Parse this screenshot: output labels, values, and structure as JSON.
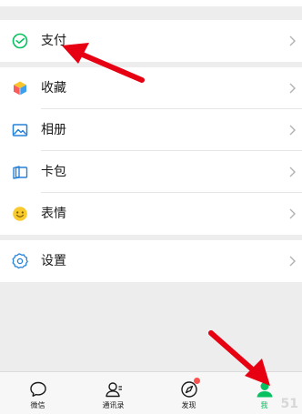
{
  "menu": {
    "pay": {
      "label": "支付",
      "icon": "pay-icon"
    },
    "items": [
      {
        "label": "收藏",
        "icon": "favorites-icon"
      },
      {
        "label": "相册",
        "icon": "album-icon"
      },
      {
        "label": "卡包",
        "icon": "card-wallet-icon"
      },
      {
        "label": "表情",
        "icon": "sticker-icon"
      }
    ],
    "settings": {
      "label": "设置",
      "icon": "settings-icon"
    }
  },
  "tabs": [
    {
      "label": "微信",
      "icon": "chat-icon",
      "active": false
    },
    {
      "label": "通讯录",
      "icon": "contacts-icon",
      "active": false
    },
    {
      "label": "发现",
      "icon": "discover-icon",
      "active": false,
      "badge_dot": true
    },
    {
      "label": "我",
      "icon": "me-icon",
      "active": true
    }
  ],
  "colors": {
    "accent": "#07c160",
    "annotation_arrow": "#e60012",
    "badge": "#fa5151"
  },
  "watermark": "51"
}
